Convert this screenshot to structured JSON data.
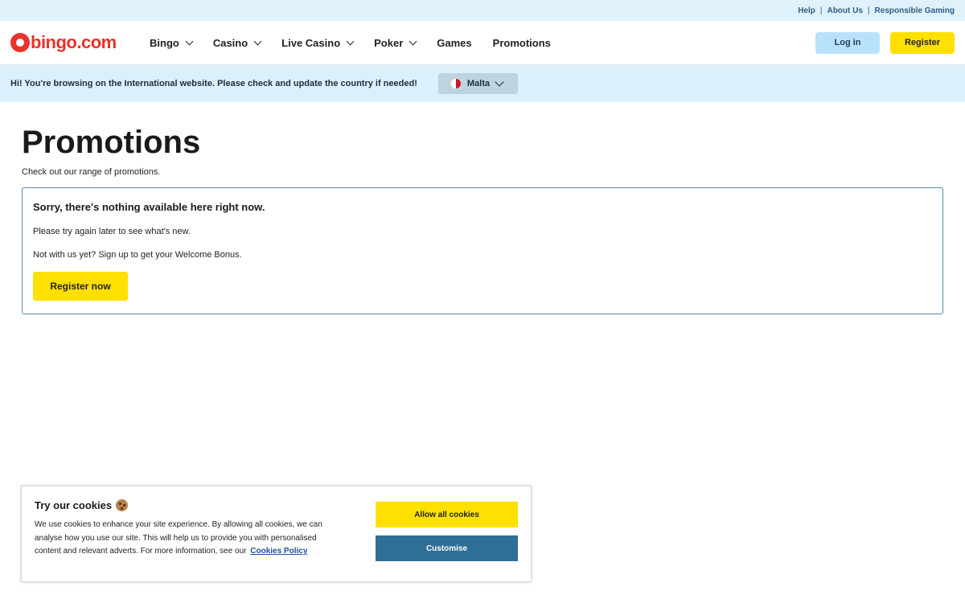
{
  "topbar": {
    "links": [
      "Help",
      "About Us",
      "Responsible Gaming"
    ],
    "separator": "|"
  },
  "header": {
    "logo_text": "bingo.com",
    "nav": [
      {
        "label": "Bingo",
        "has_dropdown": true
      },
      {
        "label": "Casino",
        "has_dropdown": true
      },
      {
        "label": "Live Casino",
        "has_dropdown": true
      },
      {
        "label": "Poker",
        "has_dropdown": true
      },
      {
        "label": "Games",
        "has_dropdown": false
      },
      {
        "label": "Promotions",
        "has_dropdown": false
      }
    ],
    "login_label": "Log in",
    "register_label": "Register"
  },
  "country_bar": {
    "message": "Hi! You're browsing on the International website. Please check and update the country if needed!",
    "selected_country": "Malta"
  },
  "main": {
    "title": "Promotions",
    "subtitle": "Check out our range of promotions.",
    "empty_title": "Sorry, there's nothing available here right now.",
    "empty_line1": "Please try again later to see what's new.",
    "empty_line2": "Not with us yet? Sign up to get your Welcome Bonus.",
    "register_now_label": "Register now"
  },
  "cookie_banner": {
    "title": "Try our cookies",
    "text": "We use cookies to enhance your site experience. By allowing all cookies, we can analyse how you use our site. This will help us to provide you with personalised content and relevant adverts. For more information, see our",
    "policy_link": "Cookies Policy",
    "allow_label": "Allow all cookies",
    "customise_label": "Customise"
  },
  "colors": {
    "brand_red": "#e8322b",
    "accent_yellow": "#ffe000",
    "light_blue": "#dcf0fb",
    "customise_blue": "#2f6e95"
  }
}
